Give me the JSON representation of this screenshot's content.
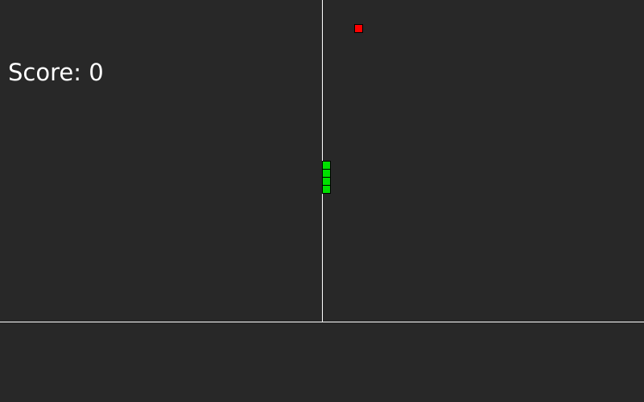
{
  "hud": {
    "score_label": "Score: 0"
  },
  "colors": {
    "background": "#282828",
    "divider": "#ffffff",
    "snake": "#00e000",
    "food": "#ff0000"
  },
  "game": {
    "snake_direction": "vertical",
    "snake_length": 4,
    "food_count": 1
  }
}
